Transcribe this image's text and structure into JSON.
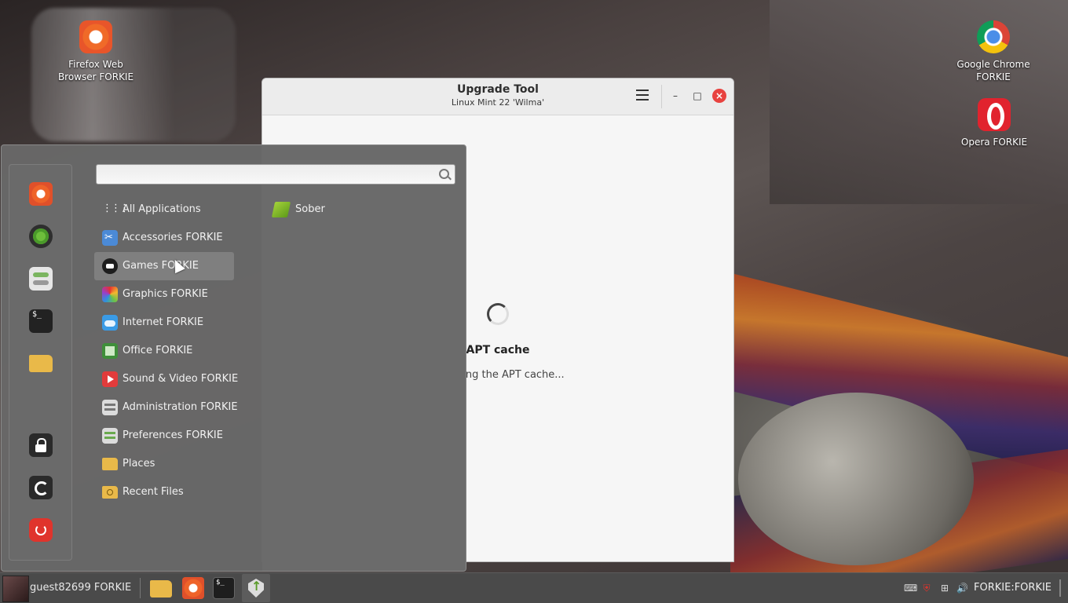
{
  "desktop": {
    "icons": [
      {
        "label": "Firefox Web Browser FORKIE",
        "icon": "firefox-icon"
      },
      {
        "label": "Google Chrome FORKIE",
        "icon": "chrome-icon"
      },
      {
        "label": "Opera FORKIE",
        "icon": "opera-icon"
      }
    ]
  },
  "window": {
    "title": "Upgrade Tool",
    "subtitle": "Linux Mint 22 'Wilma'",
    "status_title": "APT cache",
    "status_text": "Checking the APT cache..."
  },
  "menu": {
    "search": {
      "value": "",
      "placeholder": ""
    },
    "favorites": [
      "firefox-icon",
      "software-manager-icon",
      "system-settings-icon",
      "terminal-icon",
      "files-icon",
      "lock-icon",
      "logout-icon",
      "power-icon"
    ],
    "categories": [
      {
        "label": "All Applications",
        "icon": "grid-icon"
      },
      {
        "label": "Accessories FORKIE",
        "icon": "accessories-icon"
      },
      {
        "label": "Games FORKIE",
        "icon": "games-icon",
        "selected": true
      },
      {
        "label": "Graphics FORKIE",
        "icon": "graphics-icon"
      },
      {
        "label": "Internet FORKIE",
        "icon": "internet-icon"
      },
      {
        "label": "Office FORKIE",
        "icon": "office-icon"
      },
      {
        "label": "Sound & Video FORKIE",
        "icon": "sound-video-icon"
      },
      {
        "label": "Administration FORKIE",
        "icon": "administration-icon"
      },
      {
        "label": "Preferences FORKIE",
        "icon": "preferences-icon"
      },
      {
        "label": "Places",
        "icon": "folder-icon"
      },
      {
        "label": "Recent Files",
        "icon": "recent-files-icon"
      }
    ],
    "apps": [
      {
        "label": "Sober",
        "icon": "sober-icon"
      }
    ]
  },
  "taskbar": {
    "user": "guest82699 FORKIE",
    "launchers": [
      "files-icon",
      "firefox-icon",
      "terminal-icon",
      "update-manager-icon"
    ],
    "tray": [
      "keyboard-icon",
      "shield-icon",
      "network-icon",
      "volume-icon"
    ],
    "clock": "FORKIE:FORKIE"
  },
  "colors": {
    "menu_bg": "#686868",
    "selected_bg": "#7f7f7f",
    "close_button": "#e8423f",
    "taskbar_bg": "#4a4a4a"
  }
}
